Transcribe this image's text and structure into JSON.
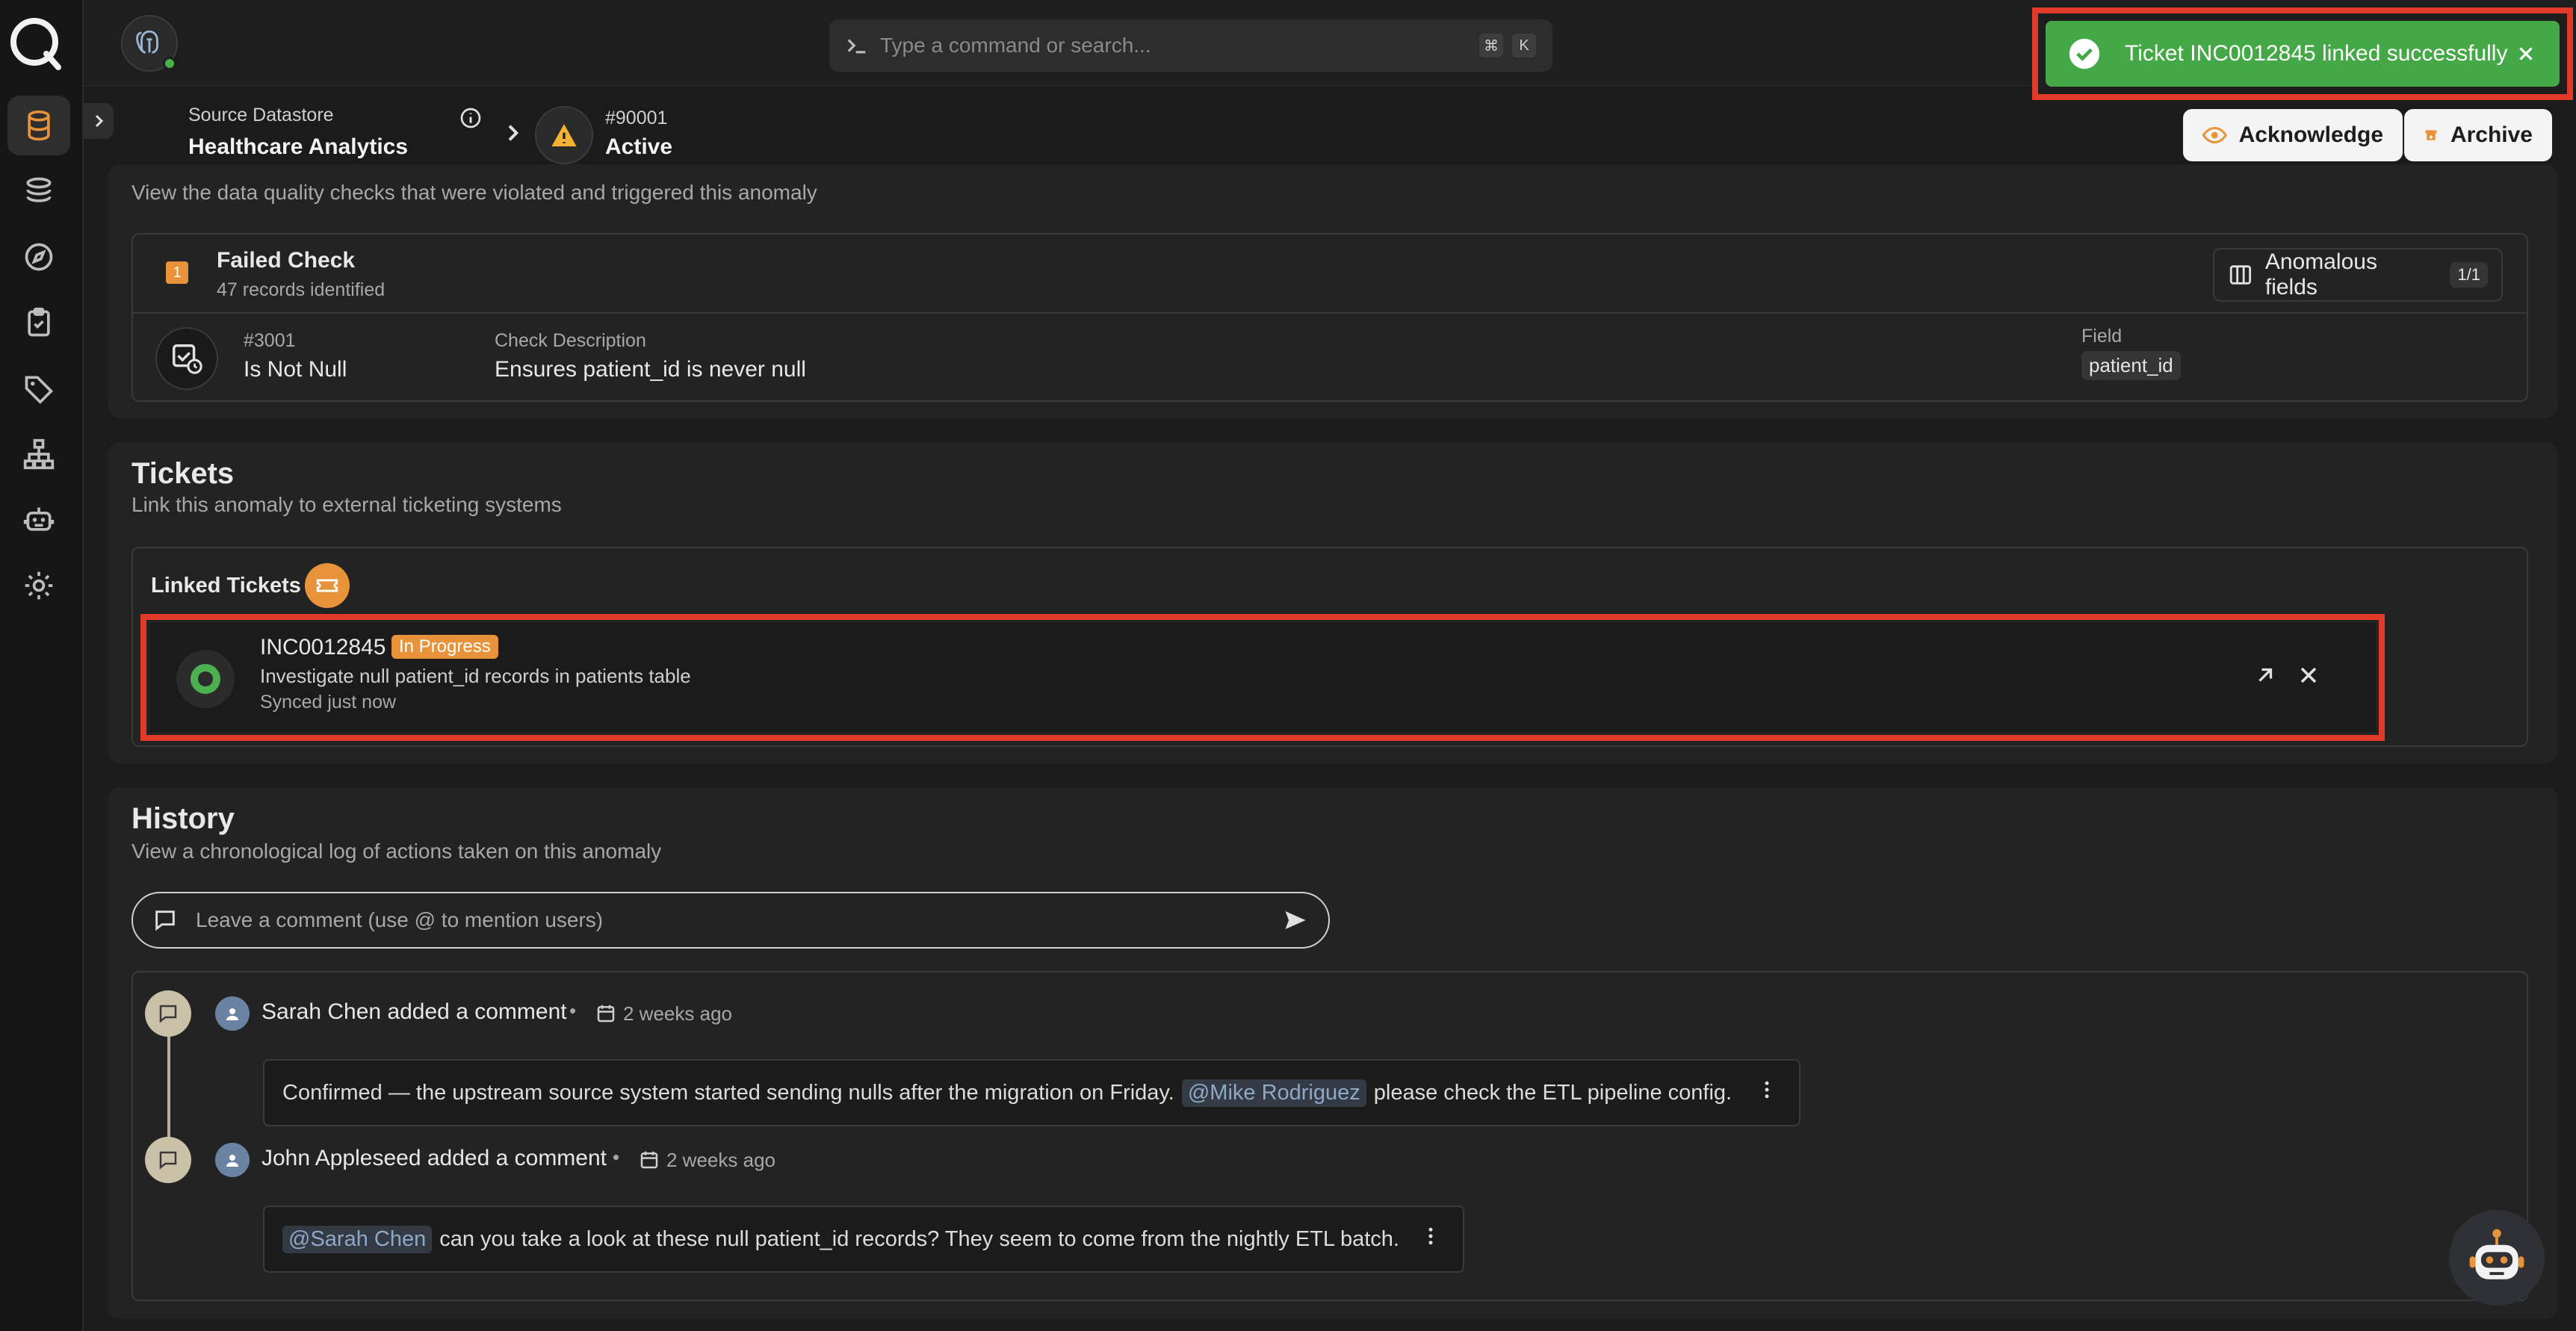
{
  "topbar": {
    "command_placeholder": "Type a command or search...",
    "shortcut_keys": [
      "⌘",
      "K"
    ]
  },
  "breadcrumb": {
    "datastore_label": "Source Datastore",
    "datastore_name": "Healthcare Analytics",
    "anomaly_id": "#90001",
    "anomaly_status": "Active"
  },
  "actions": {
    "acknowledge_label": "Acknowledge",
    "archive_label": "Archive"
  },
  "toast": {
    "message": "Ticket INC0012845 linked successfully"
  },
  "checks": {
    "description": "View the data quality checks that were violated and triggered this anomaly",
    "failed_count": "1",
    "failed_title": "Failed Check",
    "failed_records": "47 records identified",
    "anomalous_fields_label": "Anomalous fields",
    "anomalous_fields_count": "1/1",
    "check_id": "#3001",
    "check_name": "Is Not Null",
    "check_description_label": "Check Description",
    "check_description_value": "Ensures patient_id is never null",
    "field_label": "Field",
    "field_value": "patient_id"
  },
  "tickets": {
    "title": "Tickets",
    "subtitle": "Link this anomaly to external ticketing systems",
    "linked_title": "Linked Tickets",
    "items": [
      {
        "id": "INC0012845",
        "status": "In Progress",
        "summary": "Investigate null patient_id records in patients table",
        "sync": "Synced just now"
      }
    ]
  },
  "history": {
    "title": "History",
    "subtitle": "View a chronological log of actions taken on this anomaly",
    "comment_placeholder": "Leave a comment (use @ to mention users)",
    "entries": [
      {
        "author_action": "Sarah Chen added a comment",
        "separator": "•",
        "time": "2 weeks ago",
        "text_before": "Confirmed — the upstream source system started sending nulls after the migration on Friday.",
        "mention": "@Mike Rodriguez",
        "text_after": "please check the ETL pipeline config."
      },
      {
        "author_action": "John Appleseed added a comment",
        "separator": "•",
        "time": "2 weeks ago",
        "mention": "@Sarah Chen",
        "text_after": "can you take a look at these null patient_id records? They seem to come from the nightly ETL batch."
      }
    ]
  },
  "colors": {
    "accent_orange": "#e8923a",
    "toast_green": "#45a847",
    "highlight_red": "#e03a2a"
  }
}
